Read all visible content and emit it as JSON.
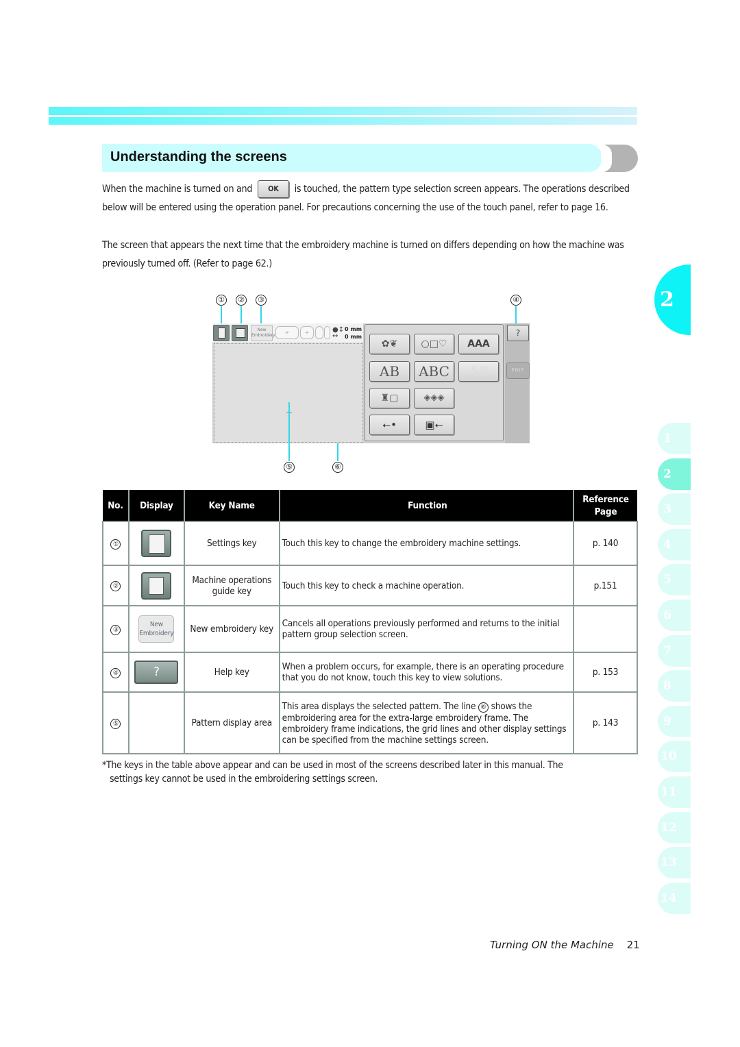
{
  "heading": {
    "title": "Understanding the screens"
  },
  "intro": {
    "p1_before": "When the machine is turned on and",
    "ok_key_label": "OK",
    "p1_after": "is touched, the pattern type selection screen appears. The operations described below will be entered using the operation panel. For precautions concerning the use of the touch panel, refer to page 16.",
    "p2": "The screen that appears the next time that the embroidery machine is turned on differs depending on how the machine was previously turned off. (Refer to page 62.)"
  },
  "callouts": [
    "①",
    "②",
    "③",
    "④",
    "⑤",
    "⑥"
  ],
  "screen": {
    "new_key_label": [
      "New",
      "Embroidery"
    ],
    "frame_plus": "+",
    "size_readout": [
      "0 mm",
      "0 mm"
    ],
    "categories": [
      {
        "icon": "bird-flower-icon",
        "label": "✿❦"
      },
      {
        "icon": "frame-shapes-icon",
        "label": "○□♡"
      },
      {
        "icon": "alphabet-font-icon",
        "label": "AAA"
      },
      {
        "icon": "decorative-alphabet-icon",
        "label": "AB"
      },
      {
        "icon": "floral-alphabet-icon",
        "label": "ABC"
      },
      {
        "icon": "applique-alphabet-icon",
        "label": "AB"
      },
      {
        "icon": "machine-pocket-icon",
        "label": "♜▢"
      },
      {
        "icon": "memory-cards-icon",
        "label": "◈◈◈"
      },
      {
        "icon": "usb-icon",
        "label": "⭠•"
      },
      {
        "icon": "computer-usb-icon",
        "label": "▣⭠"
      }
    ],
    "help_label": "?",
    "edit_label": "EDIT",
    "crosshair": "+"
  },
  "table": {
    "headers": {
      "no": "No.",
      "display": "Display",
      "key_name": "Key Name",
      "function": "Function",
      "reference": "Reference Page"
    },
    "rows": [
      {
        "no": "①",
        "key_name": "Settings key",
        "function": "Touch this key to change the embroidery machine settings.",
        "page": "p. 140",
        "icon": "settings-key-icon"
      },
      {
        "no": "②",
        "key_name": "Machine operations guide key",
        "function": "Touch this key to check a machine operation.",
        "page": "p.151",
        "icon": "machine-guide-key-icon"
      },
      {
        "no": "③",
        "key_name": "New embroidery key",
        "function": "Cancels all operations previously performed and returns to the initial pattern group selection screen.",
        "page": "",
        "icon": "new-embroidery-key-icon",
        "icon_label": "New Embroidery"
      },
      {
        "no": "④",
        "key_name": "Help key",
        "function": "When a problem occurs, for example, there is an operating procedure that you do not know, touch this key to view solutions.",
        "page": "p. 153",
        "icon": "help-key-icon"
      },
      {
        "no": "⑤",
        "key_name": "Pattern display area",
        "function_before": "This area displays the selected pattern. The line",
        "function_ref": "⑥",
        "function_after": "shows the embroidering area for the extra-large embroidery frame. The embroidery frame indications, the grid lines and other display settings can be specified from the machine settings screen.",
        "page": "p. 143"
      }
    ]
  },
  "footnote": {
    "line1": "*The keys in the table above appear and can be used in most of the screens described later in this manual. The",
    "line2": "settings key cannot be used in the embroidering settings screen."
  },
  "chapter": {
    "current": "2",
    "tabs": [
      "1",
      "2",
      "3",
      "4",
      "5",
      "6",
      "7",
      "8",
      "9",
      "10",
      "11",
      "12",
      "13",
      "14"
    ],
    "active_tab": "2"
  },
  "footer": {
    "section_title": "Turning ON the Machine",
    "page_number": "21"
  },
  "colors": {
    "accent_cyan": "#0ef4f6",
    "heading_bg": "#ccfdfe",
    "active_tab": "#7ff5dc",
    "inactive_tab": "#dcfcf7",
    "leader_line": "#30d7e6"
  }
}
